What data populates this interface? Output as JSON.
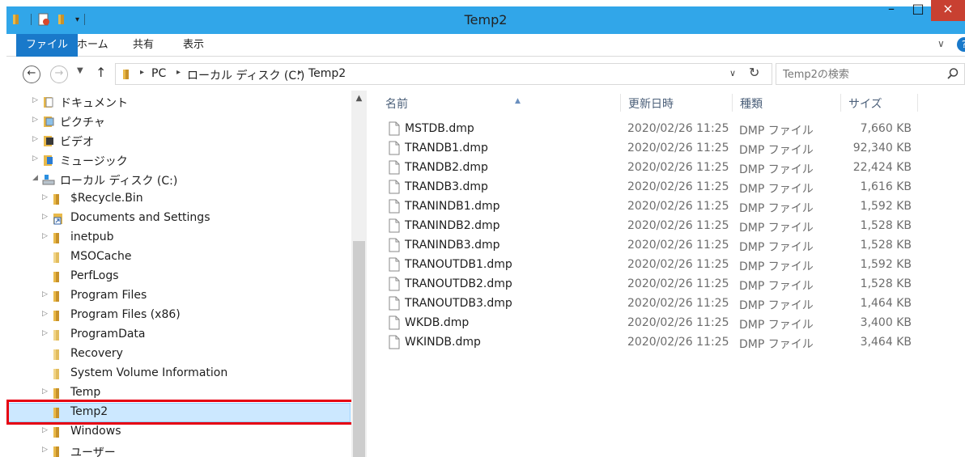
{
  "window": {
    "title": "Temp2",
    "minimize": "–",
    "maximize": "□",
    "close": "×"
  },
  "ribbon": {
    "tabs": [
      {
        "label": "ファイル"
      },
      {
        "label": "ホーム"
      },
      {
        "label": "共有"
      },
      {
        "label": "表示"
      }
    ],
    "expand": "∨",
    "help": "?"
  },
  "address": {
    "back": "←",
    "forward": "→",
    "recent": "▼",
    "up": "↑",
    "crumbs": [
      "PC",
      "ローカル ディスク (C:)",
      "Temp2"
    ],
    "separator": "▸",
    "dropdown": "∨",
    "refresh": "↻"
  },
  "search": {
    "placeholder": "Temp2の検索"
  },
  "tree": [
    {
      "label": "ドキュメント",
      "icon": "documents-icon"
    },
    {
      "label": "ピクチャ",
      "icon": "pictures-icon"
    },
    {
      "label": "ビデオ",
      "icon": "videos-icon"
    },
    {
      "label": "ミュージック",
      "icon": "music-icon"
    },
    {
      "label": "ローカル ディスク (C:)",
      "icon": "drive-icon"
    },
    {
      "label": "$Recycle.Bin",
      "icon": "folder-icon"
    },
    {
      "label": "Documents and Settings",
      "icon": "shortcut-folder-icon"
    },
    {
      "label": "inetpub",
      "icon": "folder-icon"
    },
    {
      "label": "MSOCache",
      "icon": "folder-icon"
    },
    {
      "label": "PerfLogs",
      "icon": "folder-icon"
    },
    {
      "label": "Program Files",
      "icon": "folder-icon"
    },
    {
      "label": "Program Files (x86)",
      "icon": "folder-icon"
    },
    {
      "label": "ProgramData",
      "icon": "folder-icon"
    },
    {
      "label": "Recovery",
      "icon": "folder-icon"
    },
    {
      "label": "System Volume Information",
      "icon": "folder-icon"
    },
    {
      "label": "Temp",
      "icon": "folder-icon"
    },
    {
      "label": "Temp2",
      "icon": "folder-icon"
    },
    {
      "label": "Windows",
      "icon": "folder-icon"
    },
    {
      "label": "ユーザー",
      "icon": "folder-icon"
    }
  ],
  "columns": {
    "name": "名前",
    "date": "更新日時",
    "type": "種類",
    "size": "サイズ"
  },
  "files": [
    {
      "name": "MSTDB.dmp",
      "date": "2020/02/26 11:25",
      "type": "DMP ファイル",
      "size": "7,660 KB"
    },
    {
      "name": "TRANDB1.dmp",
      "date": "2020/02/26 11:25",
      "type": "DMP ファイル",
      "size": "92,340 KB"
    },
    {
      "name": "TRANDB2.dmp",
      "date": "2020/02/26 11:25",
      "type": "DMP ファイル",
      "size": "22,424 KB"
    },
    {
      "name": "TRANDB3.dmp",
      "date": "2020/02/26 11:25",
      "type": "DMP ファイル",
      "size": "1,616 KB"
    },
    {
      "name": "TRANINDB1.dmp",
      "date": "2020/02/26 11:25",
      "type": "DMP ファイル",
      "size": "1,592 KB"
    },
    {
      "name": "TRANINDB2.dmp",
      "date": "2020/02/26 11:25",
      "type": "DMP ファイル",
      "size": "1,528 KB"
    },
    {
      "name": "TRANINDB3.dmp",
      "date": "2020/02/26 11:25",
      "type": "DMP ファイル",
      "size": "1,528 KB"
    },
    {
      "name": "TRANOUTDB1.dmp",
      "date": "2020/02/26 11:25",
      "type": "DMP ファイル",
      "size": "1,592 KB"
    },
    {
      "name": "TRANOUTDB2.dmp",
      "date": "2020/02/26 11:25",
      "type": "DMP ファイル",
      "size": "1,528 KB"
    },
    {
      "name": "TRANOUTDB3.dmp",
      "date": "2020/02/26 11:25",
      "type": "DMP ファイル",
      "size": "1,464 KB"
    },
    {
      "name": "WKDB.dmp",
      "date": "2020/02/26 11:25",
      "type": "DMP ファイル",
      "size": "3,400 KB"
    },
    {
      "name": "WKINDB.dmp",
      "date": "2020/02/26 11:25",
      "type": "DMP ファイル",
      "size": "3,464 KB"
    }
  ],
  "colors": {
    "titlebar": "#31a6e9",
    "file_tab": "#1979ca",
    "close_button": "#c84031",
    "selection": "#cce8ff",
    "highlight_outline": "#e60012",
    "folder": "#e9b949"
  }
}
